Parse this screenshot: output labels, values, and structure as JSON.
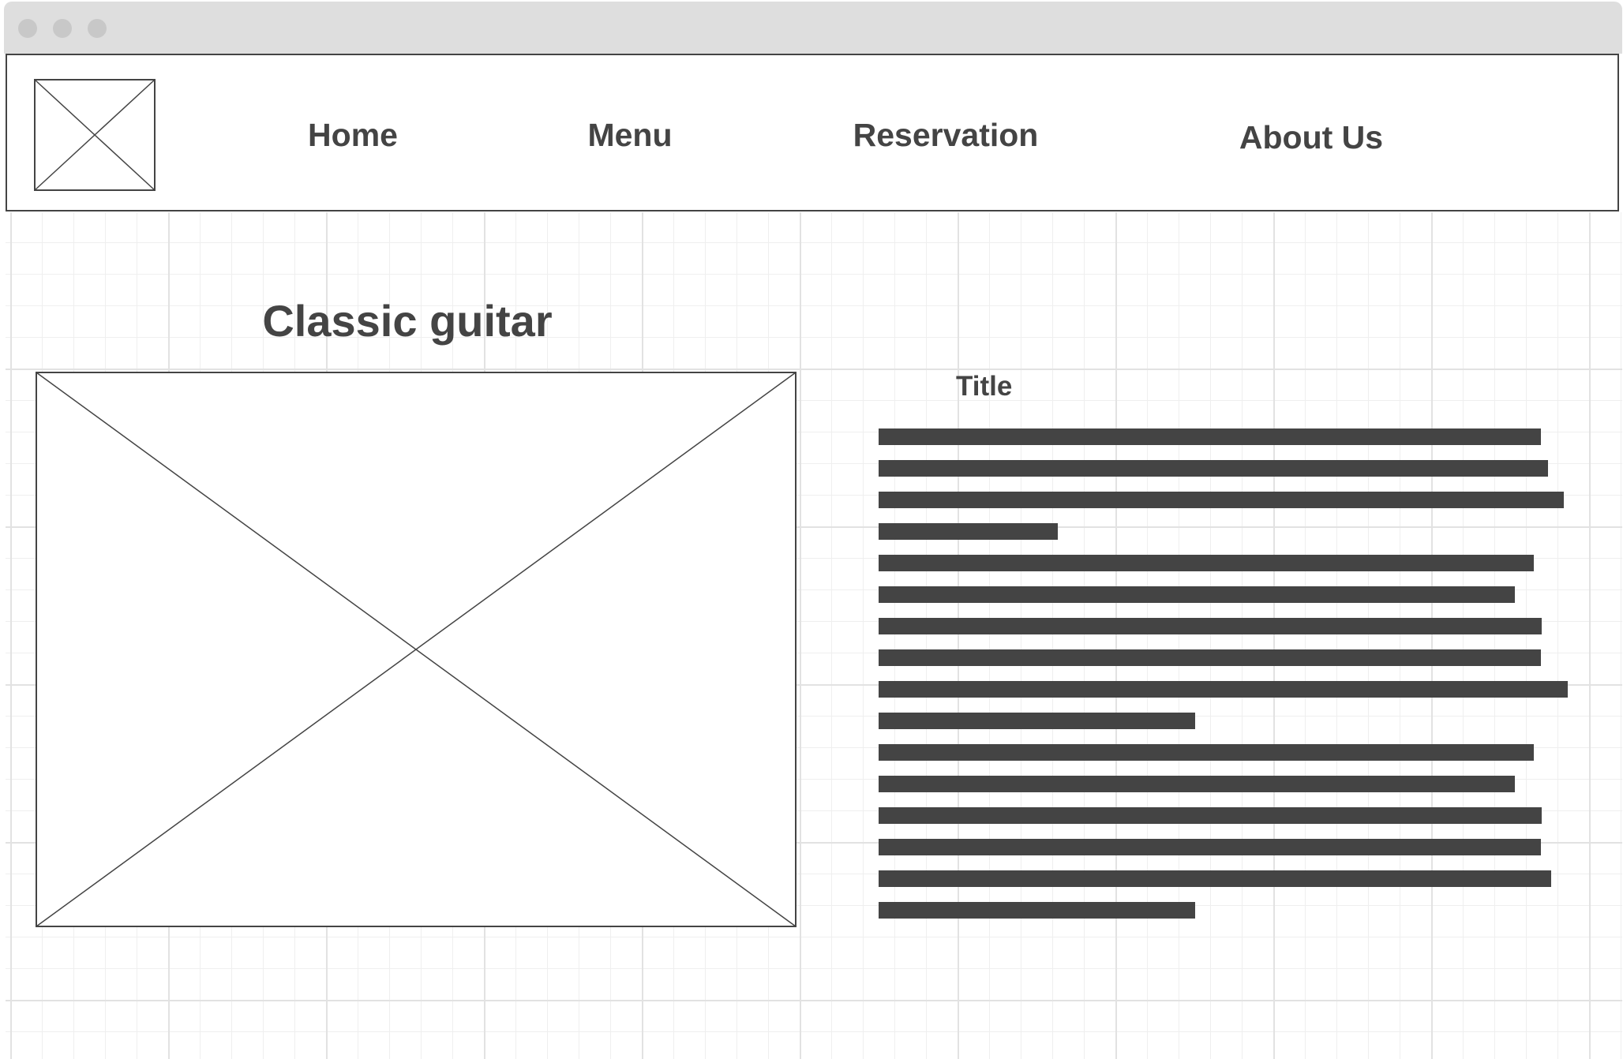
{
  "nav": {
    "logo": "logo-placeholder",
    "items": [
      {
        "label": "Home"
      },
      {
        "label": "Menu"
      },
      {
        "label": "Reservation"
      },
      {
        "label": "About Us"
      }
    ]
  },
  "main": {
    "heading": "Classic guitar",
    "image": "image-placeholder",
    "content_title": "Title",
    "text_placeholder_lines": 16
  },
  "colors": {
    "ink": "#444444",
    "titlebar": "#dedede",
    "grid": "#e2e2e2"
  }
}
